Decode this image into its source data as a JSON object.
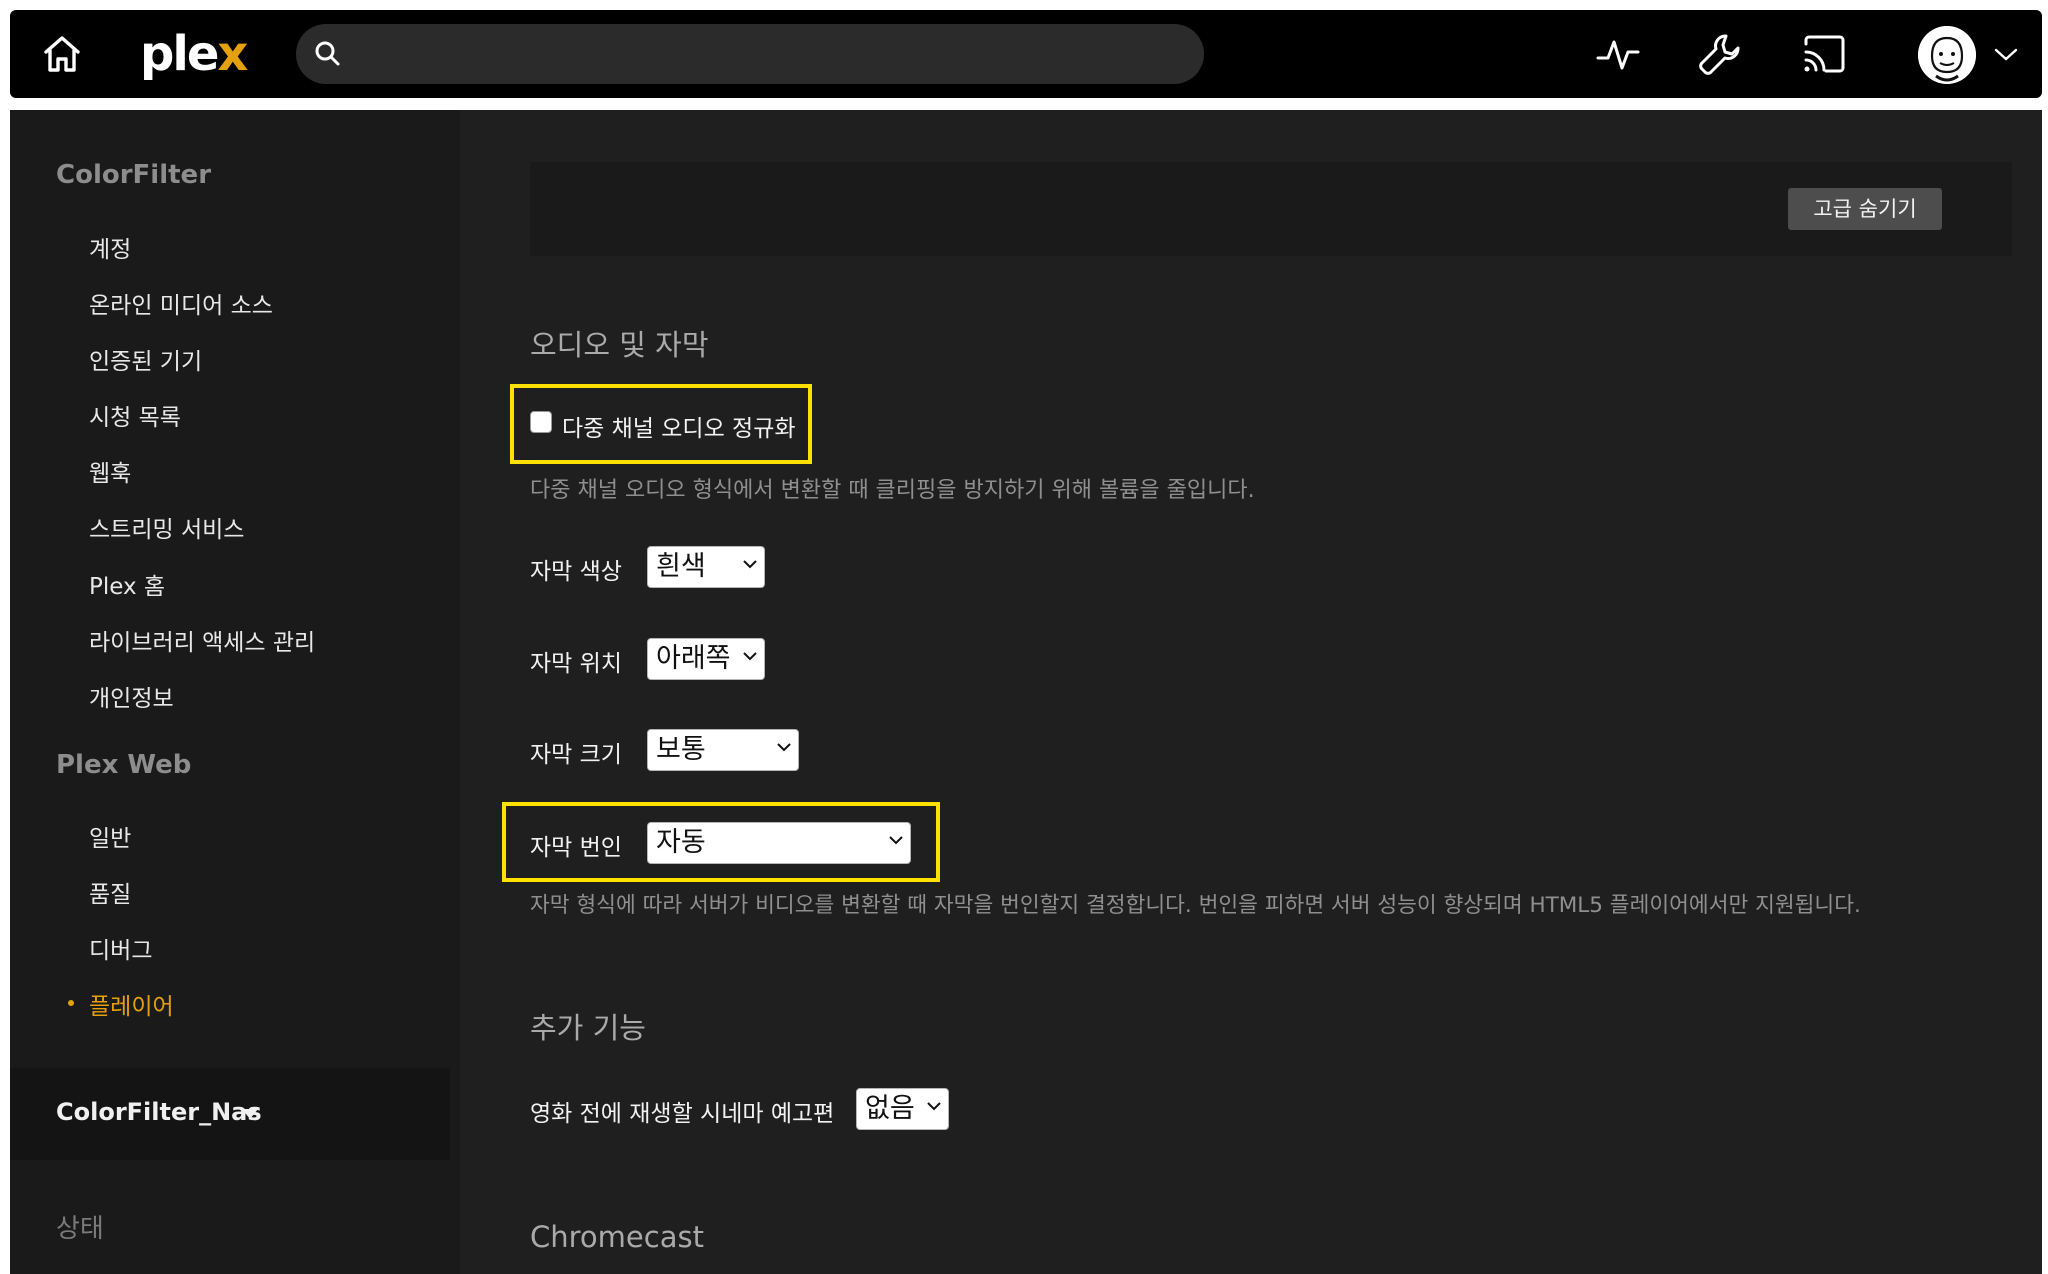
{
  "topbar": {
    "logo_main": "ple",
    "logo_accent": "x",
    "search_placeholder": ""
  },
  "sidebar": {
    "section1_title": "ColorFilter",
    "section1_items": [
      "계정",
      "온라인 미디어 소스",
      "인증된 기기",
      "시청 목록",
      "웹훅",
      "스트리밍 서비스",
      "Plex 홈",
      "라이브러리 액세스 관리",
      "개인정보"
    ],
    "section2_title": "Plex Web",
    "section2_items": [
      "일반",
      "품질",
      "디버그",
      "플레이어"
    ],
    "active_item": "플레이어",
    "server_name": "ColorFilter_Nas",
    "status_title": "상태"
  },
  "main": {
    "advanced_button": "고급 숨기기",
    "audio_section_title": "오디오 및 자막",
    "multichannel_checkbox_label": "다중 채널 오디오 정규화",
    "multichannel_checked": false,
    "multichannel_help": "다중 채널 오디오 형식에서 변환할 때 클리핑을 방지하기 위해 볼륨을 줄입니다.",
    "subtitle_color_label": "자막 색상",
    "subtitle_color_value": "흰색",
    "subtitle_position_label": "자막 위치",
    "subtitle_position_value": "아래쪽",
    "subtitle_size_label": "자막 크기",
    "subtitle_size_value": "보통",
    "subtitle_burn_label": "자막 번인",
    "subtitle_burn_value": "자동",
    "subtitle_burn_help": "자막 형식에 따라 서버가 비디오를 변환할 때 자막을 번인할지 결정합니다. 번인을 피하면 서버 성능이 향상되며 HTML5 플레이어에서만 지원됩니다.",
    "extras_section_title": "추가 기능",
    "trailers_label": "영화 전에 재생할 시네마 예고편",
    "trailers_value": "없음",
    "chromecast_section_title": "Chromecast"
  },
  "colors": {
    "accent": "#e5a00d",
    "highlight_box": "#ffe100",
    "background": "#1f1f1f",
    "topbar": "#000000"
  },
  "icons": [
    "home-icon",
    "search-icon",
    "activity-icon",
    "wrench-icon",
    "cast-icon",
    "avatar",
    "chevron-down-icon"
  ]
}
